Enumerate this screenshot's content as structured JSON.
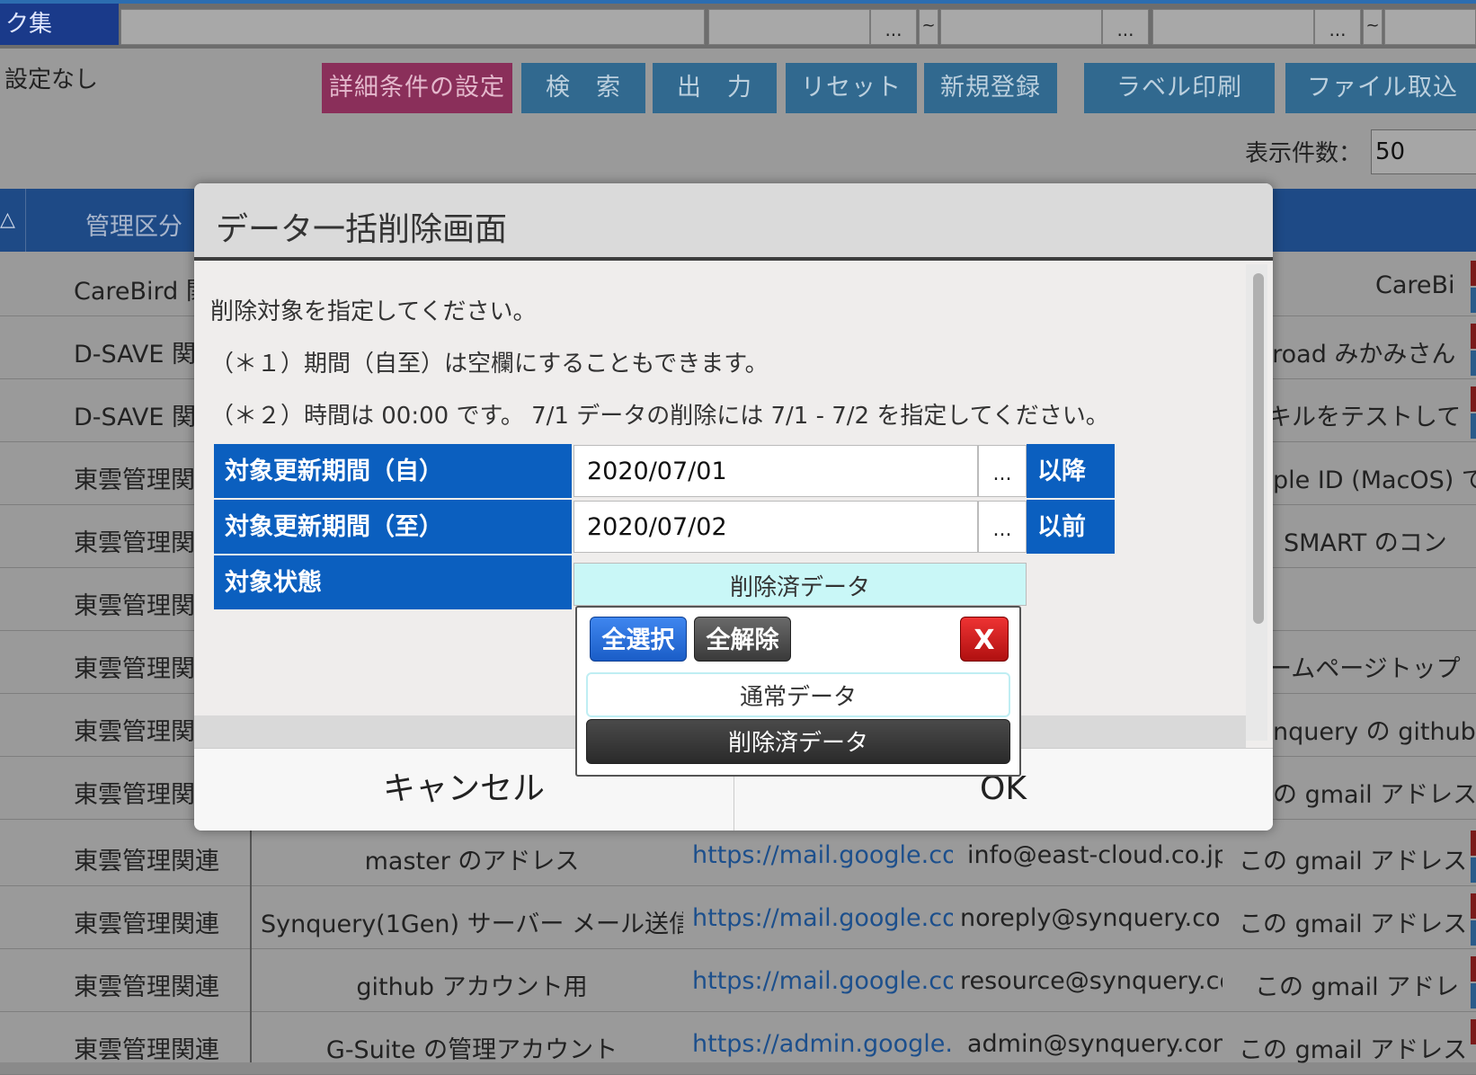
{
  "background": {
    "tab_title": "ク集",
    "no_setting": "設定なし",
    "buttons": {
      "detail": "詳細条件の設定",
      "search": "検　索",
      "output": "出　力",
      "reset": "リセット",
      "new": "新規登録",
      "label_print": "ラベル印刷",
      "file_import": "ファイル取込"
    },
    "top_dots": "...",
    "top_tilde": "~",
    "display_count_label": "表示件数：",
    "display_count_value": "50",
    "header_sort_icon": "△",
    "header_col1": "管理区分",
    "rows": [
      {
        "category": "CareBird 関",
        "right": "CareBi"
      },
      {
        "category": "D-SAVE 関",
        "right": "proad みかみさん"
      },
      {
        "category": "D-SAVE 関",
        "right": "キルをテストして"
      },
      {
        "category": "東雲管理関",
        "right": "ple ID (MacOS) で"
      },
      {
        "category": "東雲管理関",
        "right": "SMART のコン"
      },
      {
        "category": "東雲管理関",
        "right": ""
      },
      {
        "category": "東雲管理関",
        "right": "ームページトップ"
      },
      {
        "category": "東雲管理関",
        "right": "nquery の github"
      },
      {
        "category": "東雲管理関",
        "right": "の gmail アドレス"
      }
    ],
    "full_rows": [
      {
        "category": "東雲管理関連",
        "name": "master のアドレス",
        "url": "https://mail.google.com",
        "email": "info@east-cloud.co.jp",
        "note": "この gmail アドレス"
      },
      {
        "category": "東雲管理関連",
        "name": "Synquery(1Gen) サーバー メール送信",
        "url": "https://mail.google.com",
        "email": "noreply@synquery.com",
        "note": "この gmail アドレス"
      },
      {
        "category": "東雲管理関連",
        "name": "github アカウント用",
        "url": "https://mail.google.com",
        "email": "resource@synquery.com",
        "note": "この gmail アドレ"
      },
      {
        "category": "東雲管理関連",
        "name": "G-Suite の管理アカウント",
        "url": "https://admin.google.com",
        "email": "admin@synquery.com",
        "note": "この gmail アドレス"
      }
    ]
  },
  "modal": {
    "title": "データ一括削除画面",
    "msg1": "削除対象を指定してください。",
    "msg2": "（＊１）期間（自至）は空欄にすることもできます。",
    "msg3": "（＊２）時間は 00:00 です。 7/1 データの削除には 7/1 - 7/2 を指定してください。",
    "from_label": "対象更新期間（自）",
    "from_value": "2020/07/01",
    "from_suffix": "以降",
    "to_label": "対象更新期間（至）",
    "to_value": "2020/07/02",
    "to_suffix": "以前",
    "dots": "...",
    "state_label": "対象状態",
    "state_value": "削除済データ",
    "cancel": "キャンセル",
    "ok": "OK"
  },
  "popup": {
    "select_all": "全選択",
    "deselect_all": "全解除",
    "close": "X",
    "options": [
      "通常データ",
      "削除済データ"
    ]
  }
}
